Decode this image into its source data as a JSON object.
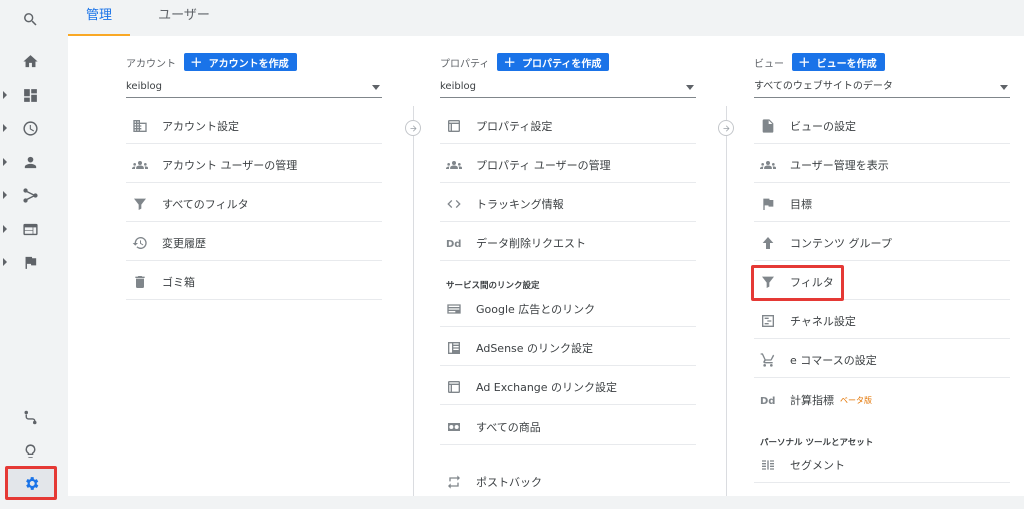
{
  "tabs": {
    "admin": "管理",
    "users": "ユーザー"
  },
  "account": {
    "label": "アカウント",
    "create": "アカウントを作成",
    "selected": "keiblog",
    "items": [
      "アカウント設定",
      "アカウント ユーザーの管理",
      "すべてのフィルタ",
      "変更履歴",
      "ゴミ箱"
    ]
  },
  "property": {
    "label": "プロパティ",
    "create": "プロパティを作成",
    "selected": "keiblog",
    "items": [
      "プロパティ設定",
      "プロパティ ユーザーの管理",
      "トラッキング情報",
      "データ削除リクエスト"
    ],
    "link_section": "サービス間のリンク設定",
    "link_items": [
      "Google 広告とのリンク",
      "AdSense のリンク設定",
      "Ad Exchange のリンク設定",
      "すべての商品"
    ],
    "extra": "ポストバック"
  },
  "view": {
    "label": "ビュー",
    "create": "ビューを作成",
    "selected": "すべてのウェブサイトのデータ",
    "items": [
      "ビューの設定",
      "ユーザー管理を表示",
      "目標",
      "コンテンツ グループ",
      "フィルタ",
      "チャネル設定",
      "e コマースの設定",
      "計算指標"
    ],
    "beta": "ベータ版",
    "personal_section": "パーソナル ツールとアセット",
    "personal_items": [
      "セグメント"
    ]
  },
  "colors": {
    "accent": "#1a73e8",
    "highlight": "#e53935",
    "tab_underline": "#f9a825"
  }
}
